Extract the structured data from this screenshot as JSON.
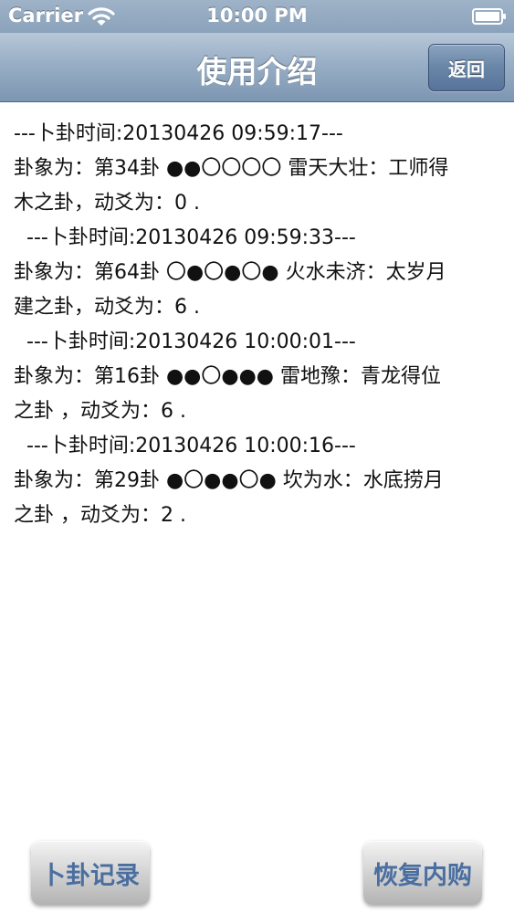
{
  "status_bar": {
    "carrier": "Carrier",
    "time": "10:00 PM",
    "wifi_icon": "wifi-icon",
    "battery_icon": "battery-icon"
  },
  "nav": {
    "title": "使用介绍",
    "back_label": "返回"
  },
  "records": [
    {
      "header": "---卜卦时间:20130426 09:59:17---",
      "line1": "卦象为：第34卦 ●●〇〇〇〇   雷天大壮：工师得",
      "line2": "木之卦，动爻为：0 ."
    },
    {
      "header": "---卜卦时间:20130426 09:59:33---",
      "line1": "卦象为：第64卦 〇●〇●〇●    火水未济：太岁月",
      "line2": "建之卦，动爻为：6 ."
    },
    {
      "header": "---卜卦时间:20130426 10:00:01---",
      "line1": "卦象为：第16卦 ●●〇●●●      雷地豫：青龙得位",
      "line2": "之卦 ，动爻为：6 ."
    },
    {
      "header": "---卜卦时间:20130426 10:00:16---",
      "line1": "卦象为：第29卦 ●〇●●〇●     坎为水：水底捞月",
      "line2": "之卦 ，动爻为：2 ."
    }
  ],
  "bottom": {
    "record_label": "卜卦记录",
    "restore_label": "恢复内购"
  },
  "colors": {
    "nav_bar": "#8aa2bb",
    "button_text": "#4a6ea0",
    "body_text": "#111111"
  }
}
